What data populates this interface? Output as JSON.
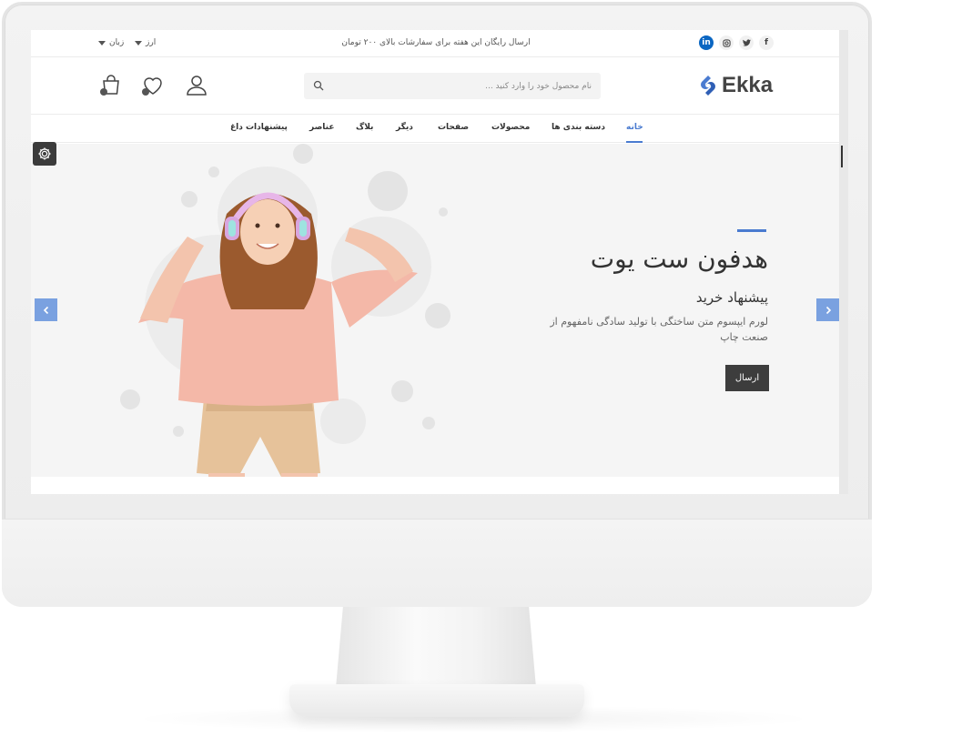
{
  "topbar": {
    "promo": "ارسال رایگان این هفته برای سفارشات بالای ۲۰۰ تومان",
    "language": "زبان",
    "currency": "ارز",
    "social_icons": [
      "facebook-icon",
      "twitter-icon",
      "instagram-icon",
      "linkedin-icon"
    ]
  },
  "header": {
    "logo_text": "Ekka",
    "search_placeholder": "نام محصول خود را وارد کنید ...",
    "icons": [
      "user-icon",
      "wishlist-icon",
      "cart-icon"
    ]
  },
  "nav": {
    "items": [
      "خانه",
      "دسته بندی ها",
      "محصولات",
      "صفحات",
      "دیگر",
      "بلاگ",
      "عناصر",
      "پیشنهادات داغ"
    ],
    "active_index": 0
  },
  "hero": {
    "title": "هدفون ست یوت",
    "subtitle": "پیشنهاد خرید",
    "description": "لورم ایپسوم متن ساختگی با تولید سادگی نامفهوم از صنعت چاپ",
    "button": "ارسال"
  },
  "colors": {
    "accent": "#4a7bd0",
    "dark_button": "#3d3d3d",
    "hero_bg": "#f5f5f5",
    "arrow_bg": "#7aa1e0"
  }
}
